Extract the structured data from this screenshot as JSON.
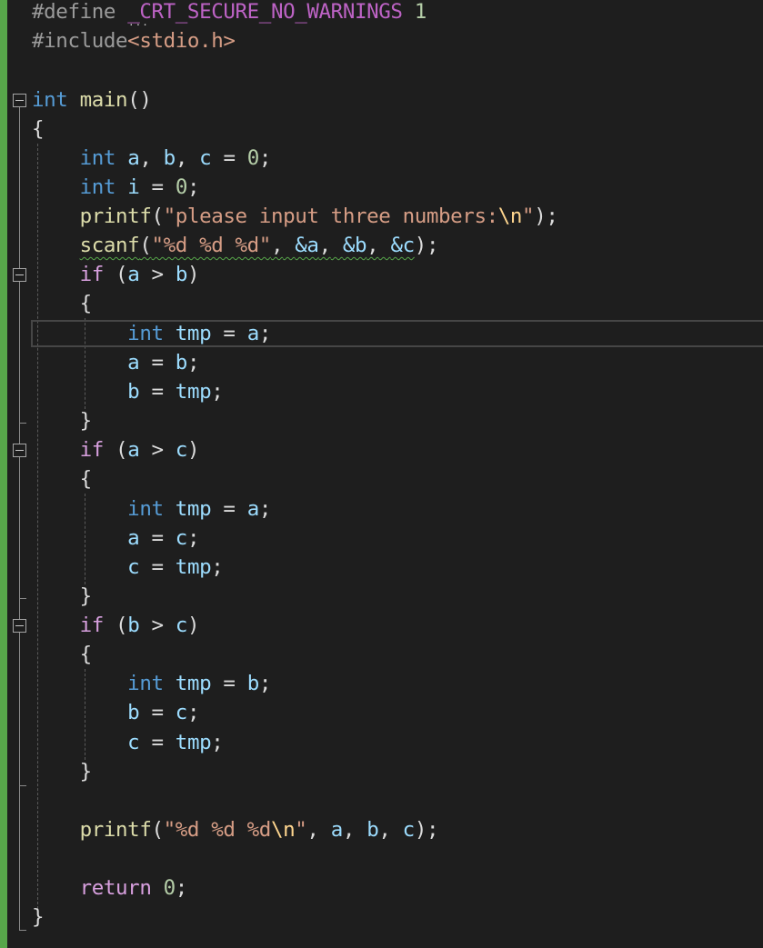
{
  "editor": {
    "colors": {
      "background": "#1e1e1e",
      "keyword": "#569cd6",
      "control": "#d8a0df",
      "string": "#d69d85",
      "number": "#b5cea8",
      "identifier": "#9cdcfe",
      "function": "#dcdcaa",
      "change_bar": "#57a64a"
    },
    "tokens": {
      "pp_define": "#define",
      "macro_name": "_CRT_SECURE_NO_WARNINGS",
      "macro_value": "1",
      "pp_include": "#include",
      "include_file": "<stdio.h>",
      "kw_int": "int",
      "fn_main": "main",
      "parens": "()",
      "brace_open": "{",
      "brace_close": "}",
      "var_a": "a",
      "var_b": "b",
      "var_c": "c",
      "var_i": "i",
      "var_tmp": "tmp",
      "comma": ",",
      "assign": "=",
      "semi": ";",
      "num_zero": "0",
      "fn_printf": "printf",
      "fn_scanf": "scanf",
      "lparen": "(",
      "rparen": ")",
      "str_prompt_text": "\"please input three numbers:",
      "esc_newline": "\\n",
      "quote": "\"",
      "str_fmt_scanf": "\"%d %d %d\"",
      "str_fmt_printf": "\"%d %d %d",
      "amp_a": "&a",
      "amp_b": "&b",
      "amp_c": "&c",
      "kw_if": "if",
      "gt": ">",
      "kw_return": "return",
      "squiggle_dots": "..."
    }
  }
}
